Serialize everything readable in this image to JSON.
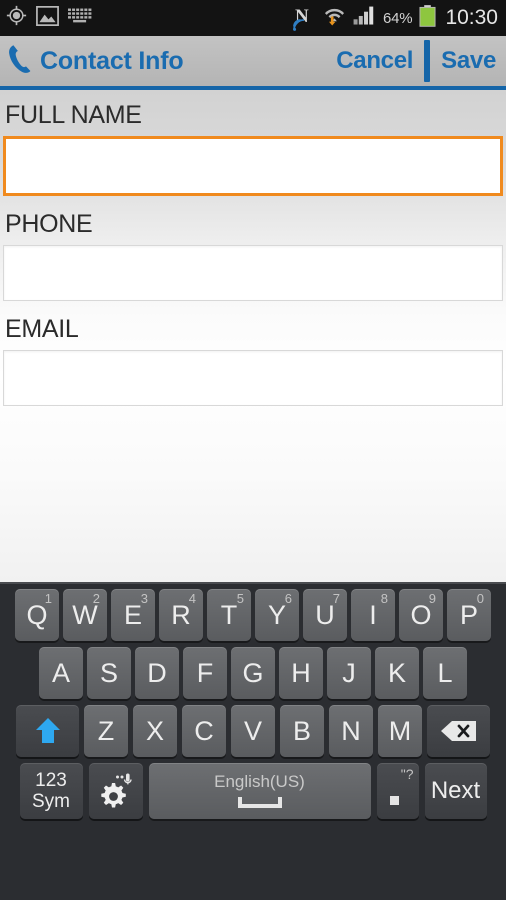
{
  "statusbar": {
    "left_icons": [
      "gps-location-icon",
      "image-gallery-icon",
      "keyboard-icon"
    ],
    "nfc_label": "N",
    "right_icons": [
      "nfc-icon",
      "wifi-download-icon",
      "signal-bars-icon"
    ],
    "battery_percent": "64%",
    "clock": "10:30"
  },
  "titlebar": {
    "icon": "phone-handset-icon",
    "title": "Contact Info",
    "cancel_label": "Cancel",
    "save_label": "Save",
    "accent_color": "#1a6cb0"
  },
  "form": {
    "fields": [
      {
        "label": "FULL NAME",
        "value": "",
        "placeholder": "",
        "focused": true
      },
      {
        "label": "PHONE",
        "value": "",
        "placeholder": "",
        "focused": false
      },
      {
        "label": "EMAIL",
        "value": "",
        "placeholder": "",
        "focused": false
      }
    ],
    "focus_color": "#f08a1e"
  },
  "keyboard": {
    "row1": [
      {
        "glyph": "Q",
        "sup": "1"
      },
      {
        "glyph": "W",
        "sup": "2"
      },
      {
        "glyph": "E",
        "sup": "3"
      },
      {
        "glyph": "R",
        "sup": "4"
      },
      {
        "glyph": "T",
        "sup": "5"
      },
      {
        "glyph": "Y",
        "sup": "6"
      },
      {
        "glyph": "U",
        "sup": "7"
      },
      {
        "glyph": "I",
        "sup": "8"
      },
      {
        "glyph": "O",
        "sup": "9"
      },
      {
        "glyph": "P",
        "sup": "0"
      }
    ],
    "row2": [
      {
        "glyph": "A"
      },
      {
        "glyph": "S"
      },
      {
        "glyph": "D"
      },
      {
        "glyph": "F"
      },
      {
        "glyph": "G"
      },
      {
        "glyph": "H"
      },
      {
        "glyph": "J"
      },
      {
        "glyph": "K"
      },
      {
        "glyph": "L"
      }
    ],
    "row3": [
      {
        "glyph": "Z"
      },
      {
        "glyph": "X"
      },
      {
        "glyph": "C"
      },
      {
        "glyph": "V"
      },
      {
        "glyph": "B"
      },
      {
        "glyph": "N"
      },
      {
        "glyph": "M"
      }
    ],
    "shift_icon": "shift-arrow-icon",
    "backspace_icon": "backspace-icon",
    "sym_line1": "123",
    "sym_line2": "Sym",
    "gear_icon": "settings-gear-mic-icon",
    "space_label": "English(US)",
    "space_icon": "space-bar-icon",
    "period_sup": "\"?",
    "period_glyph": ".",
    "next_label": "Next"
  }
}
